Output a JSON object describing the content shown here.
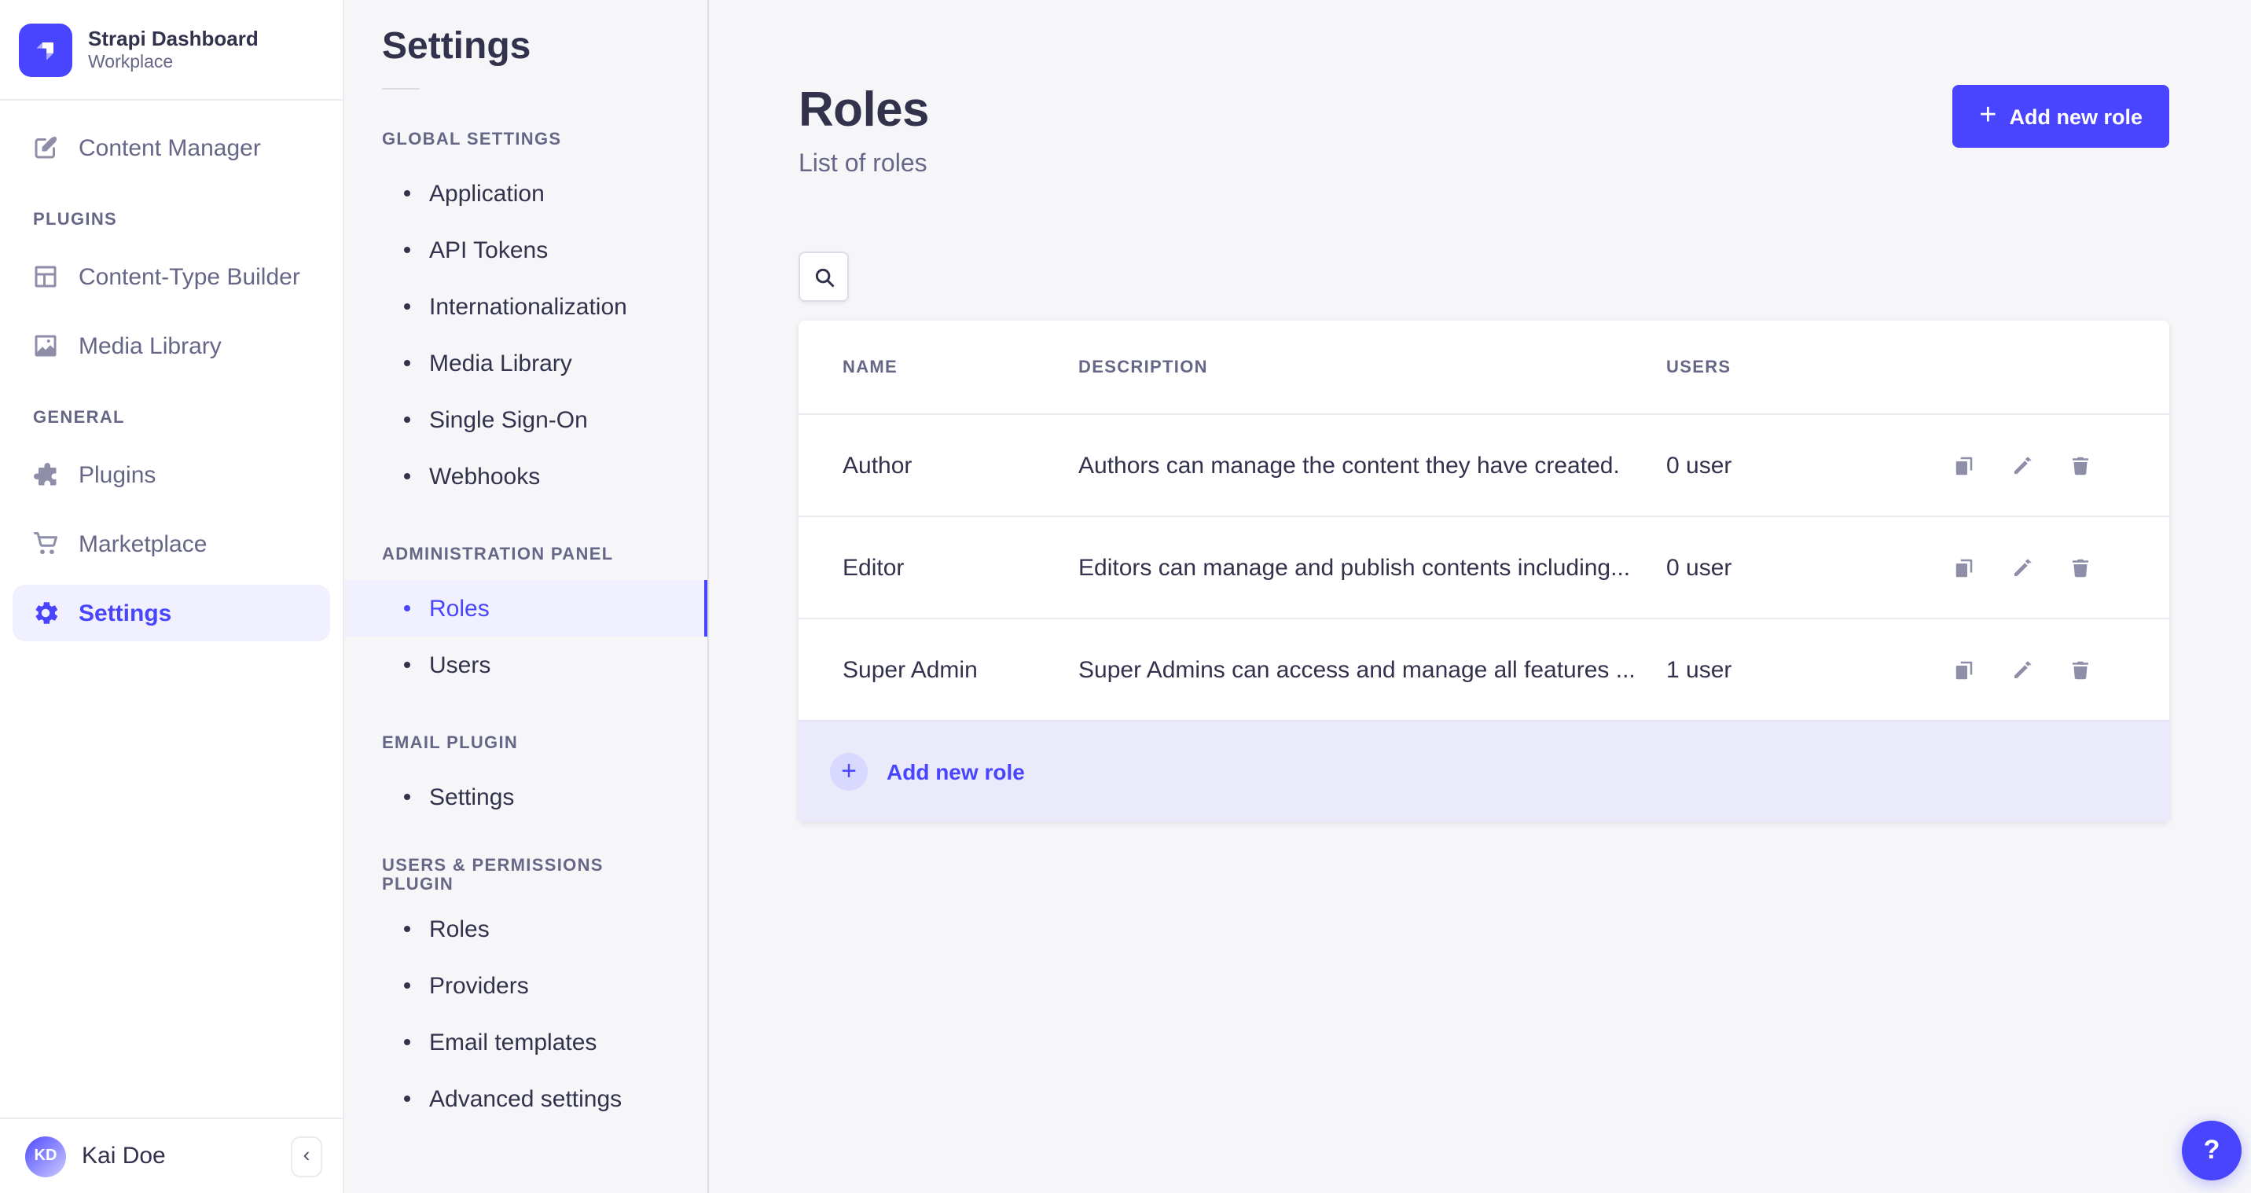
{
  "colors": {
    "primary": "#4945ff",
    "primary_light_bg": "#f0f0ff",
    "footer_row_bg": "#eaeafb",
    "plus_circle_bg": "#d9d8ff",
    "text_dark": "#32324d",
    "text_muted": "#666687",
    "icon_muted": "#8e8ea9",
    "page_bg": "#f6f6f9"
  },
  "brand": {
    "title": "Strapi Dashboard",
    "subtitle": "Workplace"
  },
  "sidebar": {
    "primary_item": {
      "label": "Content Manager",
      "icon": "content-manager"
    },
    "sections": [
      {
        "label": "PLUGINS",
        "items": [
          {
            "label": "Content-Type Builder",
            "icon": "content-type-builder"
          },
          {
            "label": "Media Library",
            "icon": "media-library"
          }
        ]
      },
      {
        "label": "GENERAL",
        "items": [
          {
            "label": "Plugins",
            "icon": "puzzle"
          },
          {
            "label": "Marketplace",
            "icon": "cart"
          },
          {
            "label": "Settings",
            "icon": "gear",
            "active": true
          }
        ]
      }
    ],
    "user": {
      "initials": "KD",
      "name": "Kai Doe"
    },
    "collapse_icon": "‹"
  },
  "subnav": {
    "title": "Settings",
    "sections": [
      {
        "label": "GLOBAL SETTINGS",
        "items": [
          "Application",
          "API Tokens",
          "Internationalization",
          "Media Library",
          "Single Sign-On",
          "Webhooks"
        ]
      },
      {
        "label": "ADMINISTRATION PANEL",
        "items": [
          "Roles",
          "Users"
        ],
        "active_item": "Roles"
      },
      {
        "label": "EMAIL PLUGIN",
        "items": [
          "Settings"
        ]
      },
      {
        "label": "USERS & PERMISSIONS PLUGIN",
        "items": [
          "Roles",
          "Providers",
          "Email templates",
          "Advanced settings"
        ]
      }
    ]
  },
  "main": {
    "title": "Roles",
    "subtitle": "List of roles",
    "add_button": {
      "plus": "+",
      "label": "Add new role"
    },
    "table": {
      "headers": {
        "name": "NAME",
        "description": "DESCRIPTION",
        "users": "USERS"
      },
      "rows": [
        {
          "name": "Author",
          "description": "Authors can manage the content they have created.",
          "users": "0 user"
        },
        {
          "name": "Editor",
          "description": "Editors can manage and publish contents including...",
          "users": "0 user"
        },
        {
          "name": "Super Admin",
          "description": "Super Admins can access and manage all features ...",
          "users": "1 user"
        }
      ],
      "footer": {
        "plus": "+",
        "label": "Add new role"
      }
    },
    "help_button": "?"
  }
}
